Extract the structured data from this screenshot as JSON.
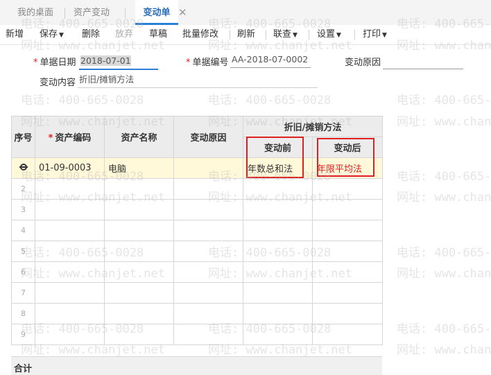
{
  "tabs": [
    {
      "label": "我的桌面"
    },
    {
      "label": "资产变动"
    },
    {
      "label": "变动单"
    }
  ],
  "toolbar": {
    "new": "新增",
    "save": "保存",
    "delete": "删除",
    "discard": "放弃",
    "draft": "草稿",
    "batch_edit": "批量修改",
    "refresh": "刷新",
    "linked_query": "联查",
    "settings": "设置",
    "print": "打印"
  },
  "form": {
    "date_label": "单据日期",
    "date_value": "2018-07-01",
    "number_label": "单据编号",
    "number_value": "AA-2018-07-0002",
    "reason_label": "变动原因",
    "reason_value": "",
    "content_label": "变动内容",
    "content_value": "折旧/摊销方法"
  },
  "grid": {
    "headers": {
      "seq": "序号",
      "asset_code": "资产编码",
      "asset_name": "资产名称",
      "change_reason": "变动原因",
      "method_group": "折旧/摊销方法",
      "before": "变动前",
      "after": "变动后"
    },
    "rows": [
      {
        "code": "01-09-0003",
        "name": "电脑",
        "reason": "",
        "before": "年数总和法",
        "after": "年限平均法"
      },
      {
        "num": "2"
      },
      {
        "num": "3"
      },
      {
        "num": "4"
      },
      {
        "num": "5"
      },
      {
        "num": "6"
      },
      {
        "num": "7"
      },
      {
        "num": "8"
      },
      {
        "num": "9"
      }
    ]
  },
  "footer": {
    "total_label": "合计"
  },
  "watermark": {
    "phone": "电话: 400-665-0028",
    "site": "网址: www.chanjet.net"
  },
  "colors": {
    "accent": "#2b7fd6",
    "required": "#e02020",
    "selected_row": "#fff8d9",
    "header_bg": "#ececec"
  }
}
